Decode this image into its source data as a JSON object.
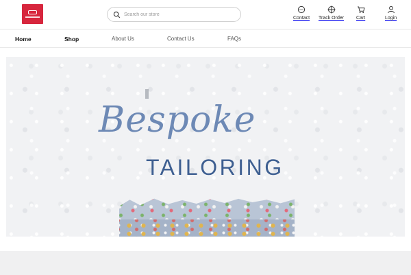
{
  "header": {
    "logo_name": "store-logo",
    "search": {
      "placeholder": "Search our store",
      "value": ""
    },
    "actions": [
      {
        "label": "Contact",
        "icon": "chat-bubble-icon"
      },
      {
        "label": "Track Order",
        "icon": "crosshair-icon"
      },
      {
        "label": "Cart",
        "icon": "cart-icon"
      },
      {
        "label": "Login",
        "icon": "user-icon"
      }
    ]
  },
  "nav": {
    "items": [
      {
        "label": "Home"
      },
      {
        "label": "Shop"
      },
      {
        "label": "About Us"
      },
      {
        "label": "Contact Us"
      },
      {
        "label": "FAQs"
      }
    ]
  },
  "banner": {
    "script_text": "Bespoke",
    "block_text": "TAILORING"
  },
  "colors": {
    "brand_red": "#d7263d",
    "banner_script": "#6d89b5",
    "banner_block": "#3e5f91"
  }
}
